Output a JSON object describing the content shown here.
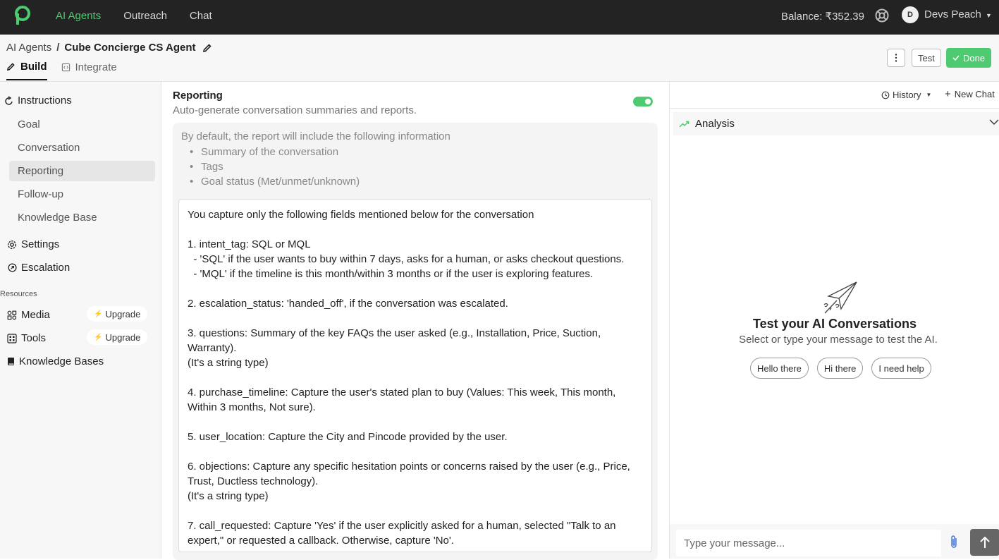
{
  "topnav": {
    "items": [
      "AI Agents",
      "Outreach",
      "Chat"
    ],
    "balance": "Balance: ₹352.39",
    "user_initial": "D",
    "user_name": "Devs Peach"
  },
  "breadcrumb": {
    "root": "AI Agents",
    "separator": "/",
    "current": "Cube Concierge CS Agent"
  },
  "tabs": [
    "Build",
    "Integrate"
  ],
  "toolbar": {
    "test_label": "Test",
    "done_label": "Done"
  },
  "sidebar": {
    "instructions_label": "Instructions",
    "items": [
      "Goal",
      "Conversation",
      "Reporting",
      "Follow-up",
      "Knowledge Base"
    ],
    "active_item": "Reporting",
    "settings_label": "Settings",
    "escalation_label": "Escalation",
    "resources_label": "Resources",
    "media_label": "Media",
    "tools_label": "Tools",
    "upgrade_label": "Upgrade",
    "knowledge_bases_label": "Knowledge Bases"
  },
  "reporting": {
    "title": "Reporting",
    "subtitle": "Auto-generate conversation summaries and reports.",
    "enabled": true,
    "info_intro": "By default, the report will include the following information",
    "info_items": [
      "Summary of the conversation",
      "Tags",
      "Goal status (Met/unmet/unknown)"
    ],
    "prompt_text": "You capture only the following fields mentioned below for the conversation\n\n1. intent_tag: SQL or MQL\n  - 'SQL' if the user wants to buy within 7 days, asks for a human, or asks checkout questions.\n  - 'MQL' if the timeline is this month/within 3 months or if the user is exploring features.\n\n2. escalation_status: 'handed_off', if the conversation was escalated.\n\n3. questions: Summary of the key FAQs the user asked (e.g., Installation, Price, Suction,\nWarranty).\n(It's a string type)\n\n4. purchase_timeline: Capture the user's stated plan to buy (Values: This week, This month,\nWithin 3 months, Not sure).\n\n5. user_location: Capture the City and Pincode provided by the user.\n\n6. objections: Capture any specific hesitation points or concerns raised by the user (e.g., Price,\nTrust, Ductless technology).\n(It's a string type)\n\n7. call_requested: Capture 'Yes' if the user explicitly asked for a human, selected \"Talk to an\nexpert,\" or requested a callback. Otherwise, capture 'No'."
  },
  "test_panel": {
    "history_label": "History",
    "new_chat_label": "New Chat",
    "analysis_label": "Analysis",
    "empty_title": "Test your AI Conversations",
    "empty_subtitle": "Select or type your message to test the AI.",
    "suggestions": [
      "Hello there",
      "Hi there",
      "I need help"
    ],
    "input_placeholder": "Type your message..."
  },
  "colors": {
    "accent": "#4ecb71",
    "topbar": "#232323"
  }
}
